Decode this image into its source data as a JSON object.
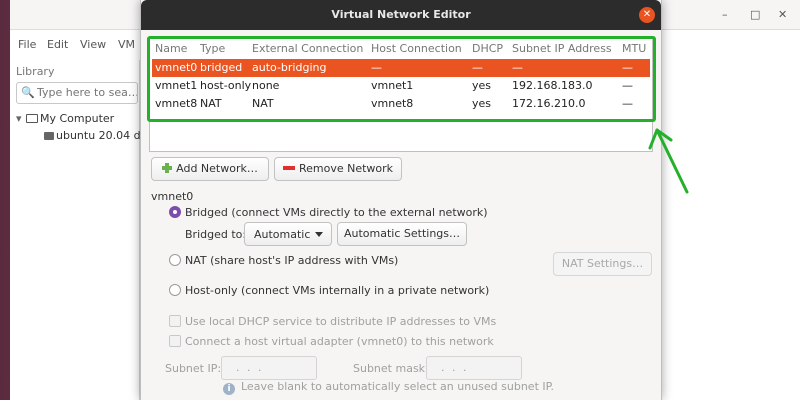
{
  "dialog": {
    "title": "Virtual Network Editor"
  },
  "background_app": {
    "window_controls": {
      "minimize": "–",
      "maximize": "□",
      "close": "✕"
    },
    "menu": [
      "File",
      "Edit",
      "View",
      "VM"
    ],
    "library": {
      "title": "Library",
      "search_placeholder": "Type here to sea…",
      "tree": [
        {
          "toggle": "▾",
          "label": "My Computer"
        },
        {
          "toggle": "",
          "label": "ubuntu 20.04 d…"
        }
      ]
    }
  },
  "network_table": {
    "columns": [
      "Name",
      "Type",
      "External Connection",
      "Host Connection",
      "DHCP",
      "Subnet IP Address",
      "MTU"
    ],
    "rows": [
      {
        "name": "vmnet0",
        "type": "bridged",
        "external": "auto-bridging",
        "host": "—",
        "dhcp": "—",
        "subnet": "—",
        "mtu": "—",
        "selected": true
      },
      {
        "name": "vmnet1",
        "type": "host-only",
        "external": "none",
        "host": "vmnet1",
        "dhcp": "yes",
        "subnet": "192.168.183.0",
        "mtu": "—",
        "selected": false
      },
      {
        "name": "vmnet8",
        "type": "NAT",
        "external": "NAT",
        "host": "vmnet8",
        "dhcp": "yes",
        "subnet": "172.16.210.0",
        "mtu": "—",
        "selected": false
      }
    ]
  },
  "buttons": {
    "add_network": "Add Network…",
    "remove_network": "Remove Network",
    "automatic_settings": "Automatic Settings…",
    "nat_settings": "NAT Settings…"
  },
  "settings": {
    "section_title": "vmnet0",
    "bridged_label": "Bridged (connect VMs directly to the external network)",
    "bridged_to_label": "Bridged to:",
    "bridged_to_value": "Automatic",
    "nat_label": "NAT (share host's IP address with VMs)",
    "host_only_label": "Host-only (connect VMs internally in a private network)",
    "dhcp_label": "Use local DHCP service to distribute IP addresses to VMs",
    "adapter_label": "Connect a host virtual adapter (vmnet0) to this network",
    "subnet_ip_label": "Subnet IP:",
    "subnet_mask_label": "Subnet mask:",
    "ip_placeholder": ". . .",
    "hint": "Leave blank to automatically select an unused subnet IP.",
    "info_glyph": "i",
    "selected_mode": "bridged"
  },
  "annotation": {
    "highlight_color": "#23b02a"
  },
  "colors": {
    "selected_row": "#e95420",
    "close_button": "#e95420",
    "radio_checked": "#7c4dab"
  }
}
